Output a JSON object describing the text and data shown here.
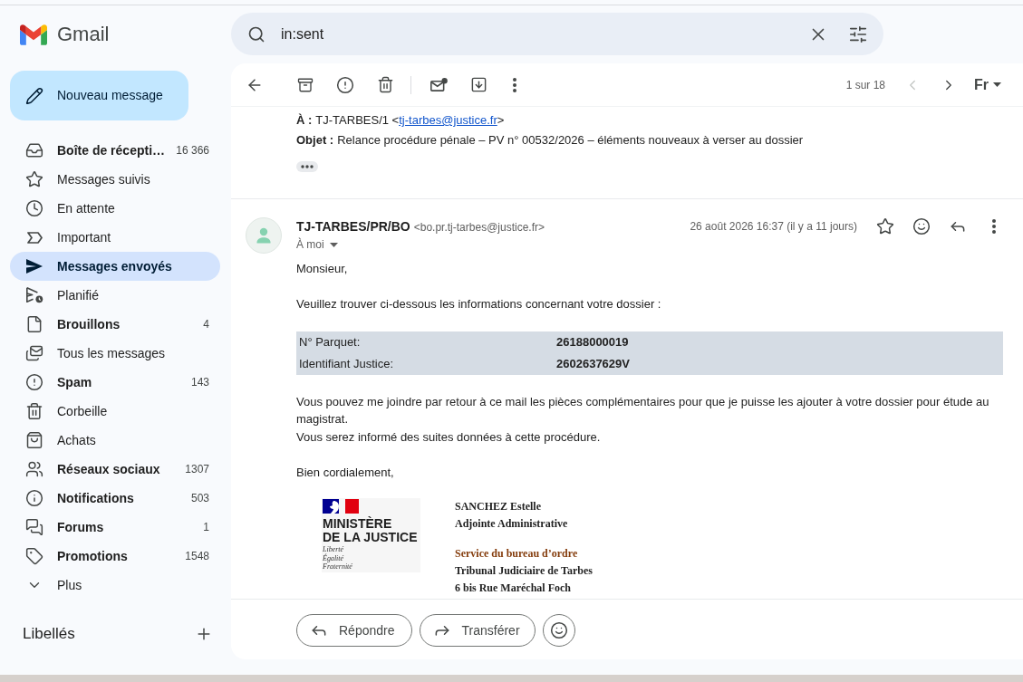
{
  "app": {
    "name": "Gmail"
  },
  "compose": {
    "label": "Nouveau message"
  },
  "nav": [
    {
      "kind": "inbox",
      "label": "Boîte de récepti…",
      "count": "16 366",
      "unread": true,
      "selected": false
    },
    {
      "kind": "starred",
      "label": "Messages suivis",
      "unread": false,
      "selected": false
    },
    {
      "kind": "snoozed",
      "label": "En attente",
      "unread": false,
      "selected": false
    },
    {
      "kind": "important",
      "label": "Important",
      "unread": false,
      "selected": false
    },
    {
      "kind": "sent",
      "label": "Messages envoyés",
      "unread": true,
      "selected": true
    },
    {
      "kind": "scheduled",
      "label": "Planifié",
      "unread": false,
      "selected": false
    },
    {
      "kind": "drafts",
      "label": "Brouillons",
      "count": "4",
      "unread": true,
      "selected": false
    },
    {
      "kind": "all",
      "label": "Tous les messages",
      "unread": false,
      "selected": false
    },
    {
      "kind": "spam",
      "label": "Spam",
      "count": "143",
      "unread": true,
      "selected": false
    },
    {
      "kind": "trash",
      "label": "Corbeille",
      "unread": false,
      "selected": false
    },
    {
      "kind": "purchases",
      "label": "Achats",
      "unread": false,
      "selected": false
    },
    {
      "kind": "social",
      "label": "Réseaux sociaux",
      "count": "1307",
      "unread": true,
      "selected": false
    },
    {
      "kind": "updates",
      "label": "Notifications",
      "count": "503",
      "unread": true,
      "selected": false
    },
    {
      "kind": "forums",
      "label": "Forums",
      "count": "1",
      "unread": true,
      "selected": false
    },
    {
      "kind": "promotions",
      "label": "Promotions",
      "count": "1548",
      "unread": true,
      "selected": false
    },
    {
      "kind": "more",
      "label": "Plus",
      "unread": false,
      "selected": false
    }
  ],
  "labels": {
    "title": "Libellés"
  },
  "search": {
    "value": "in:sent"
  },
  "toolbar": {
    "pager": "1 sur 18",
    "prev_disabled": true,
    "next_disabled": false,
    "input_tools": "Fr"
  },
  "previous_message": {
    "to": {
      "label": "À :",
      "before": "TJ-TARBES/1 <",
      "link": "tj-tarbes@justice.fr",
      "after": ">"
    },
    "subject": {
      "label": "Objet :",
      "text": "Relance procédure pénale – PV n° 00532/2026 – éléments nouveaux à verser au dossier"
    }
  },
  "message": {
    "sender": "TJ-TARBES/PR/BO",
    "sender_email": "<bo.pr.tj-tarbes@justice.fr>",
    "recipients": "À moi",
    "date": "26 août 2026 16:37 (il y a 11 jours)",
    "starred": false,
    "body": {
      "greeting": "Monsieur,",
      "intro": "Veuillez trouver ci-dessous les informations concernant votre dossier :",
      "details": [
        {
          "label": "N° Parquet:",
          "value": "26188000019"
        },
        {
          "label": "Identifiant Justice:",
          "value": "2602637629V"
        }
      ],
      "paragraphs": [
        "Vous pouvez me joindre par retour à ce mail les pièces complémentaires pour que je puisse les ajouter à votre dossier pour étude au magistrat.",
        "Vous serez informé des suites données à cette procédure."
      ],
      "closing": "Bien cordialement,"
    },
    "signature": {
      "logo": {
        "title_lines": [
          "MINISTÈRE",
          "DE LA JUSTICE"
        ],
        "motto": [
          "Liberté",
          "Égalité",
          "Fraternité"
        ]
      },
      "lines": [
        {
          "kind": "plain",
          "text": "SANCHEZ Estelle"
        },
        {
          "kind": "plain",
          "text": "Adjointe Administrative"
        },
        {
          "kind": "accent",
          "text": "Service du bureau d’ordre"
        },
        {
          "kind": "plain",
          "text": "Tribunal Judiciaire de Tarbes"
        },
        {
          "kind": "plain",
          "text": "6 bis Rue Maréchal Foch"
        }
      ]
    }
  },
  "actions": [
    {
      "kind": "reply",
      "label": "Répondre"
    },
    {
      "kind": "forward",
      "label": "Transférer"
    },
    {
      "kind": "emoji"
    }
  ]
}
